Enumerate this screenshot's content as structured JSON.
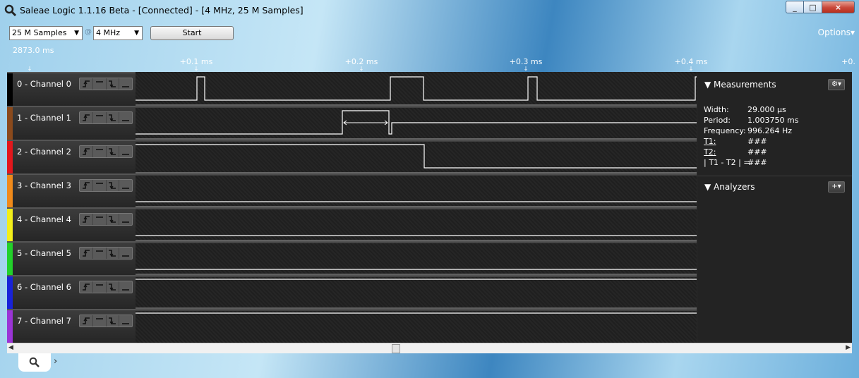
{
  "window": {
    "title": "Saleae Logic 1.1.16 Beta - [Connected] - [4 MHz, 25 M Samples]"
  },
  "window_controls": {
    "min": "_",
    "max": "□",
    "close": "×"
  },
  "toolbar": {
    "samples_value": "25 M Samples",
    "rate_separator": "@",
    "rate_value": "4 MHz",
    "start_label": "Start",
    "options_label": "Options▾"
  },
  "timeline": {
    "start_time": "2873.0 ms",
    "ticks": [
      "+0.1 ms",
      "+0.2 ms",
      "+0.3 ms",
      "+0.4 ms",
      "+0."
    ]
  },
  "channels": [
    {
      "label": "0 - Channel 0",
      "color": "#000000"
    },
    {
      "label": "1 - Channel 1",
      "color": "#8b4a1c"
    },
    {
      "label": "2 - Channel 2",
      "color": "#e3171c"
    },
    {
      "label": "3 - Channel 3",
      "color": "#f08a1a"
    },
    {
      "label": "4 - Channel 4",
      "color": "#f2ee1a"
    },
    {
      "label": "5 - Channel 5",
      "color": "#22d12a"
    },
    {
      "label": "6 - Channel 6",
      "color": "#1822d8"
    },
    {
      "label": "7 - Channel 7",
      "color": "#9b34d6"
    }
  ],
  "measurements": {
    "title": "Measurements",
    "rows": [
      {
        "label": "Width:",
        "value": "29.000 µs"
      },
      {
        "label": "Period:",
        "value": "1.003750 ms"
      },
      {
        "label": "Frequency:",
        "value": "996.264 Hz"
      },
      {
        "label": "T1:",
        "value": "###"
      },
      {
        "label": "T2:",
        "value": "###"
      },
      {
        "label": "| T1 - T2 | =",
        "value": "###"
      }
    ]
  },
  "analyzers": {
    "title": "Analyzers"
  },
  "icons": {
    "search": "search-icon",
    "gear": "gear-icon",
    "plus": "plus-icon"
  }
}
